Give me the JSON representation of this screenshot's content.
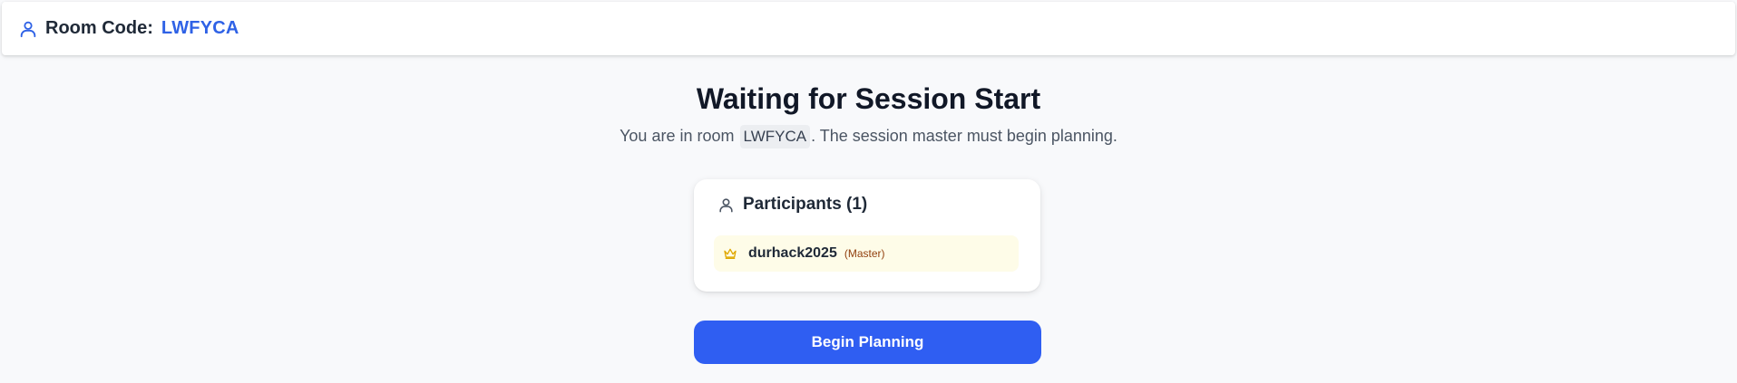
{
  "header": {
    "room_label": "Room Code:",
    "room_code": "LWFYCA",
    "icon": "user-icon",
    "accent_color": "#2f62e6"
  },
  "main": {
    "title": "Waiting for Session Start",
    "subtitle_prefix": "You are in room",
    "subtitle_code": "LWFYCA",
    "subtitle_suffix": ". The session master must begin planning."
  },
  "participants": {
    "heading": "Participants (1)",
    "icon": "user-icon",
    "items": [
      {
        "name": "durhack2025",
        "role": "(Master)",
        "icon": "crown-icon",
        "highlight_color": "#fefce8"
      }
    ]
  },
  "actions": {
    "begin_label": "Begin Planning",
    "button_color": "#2f5ef2"
  }
}
